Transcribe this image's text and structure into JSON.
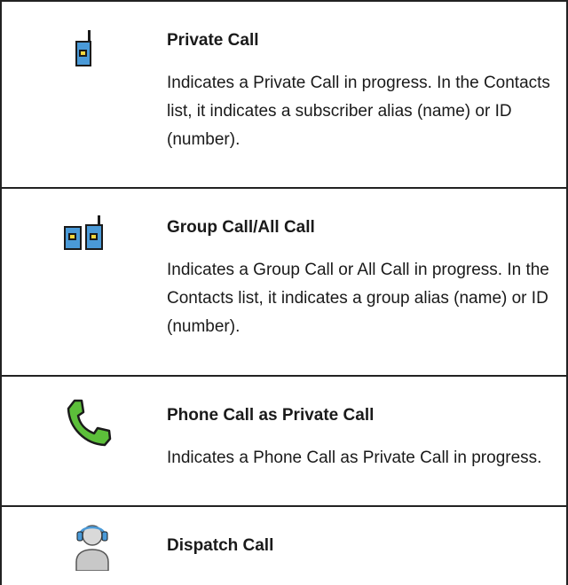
{
  "rows": [
    {
      "title": "Private Call",
      "description": "Indicates a Private Call in progress. In the Contacts list, it indicates a subscriber alias (name) or ID (number).",
      "icon": "radio-icon"
    },
    {
      "title": "Group Call/All Call",
      "description": "Indicates a Group Call or All Call in progress. In the Contacts list, it indicates a group alias (name) or ID (number).",
      "icon": "two-radios-icon"
    },
    {
      "title": "Phone Call as Private Call",
      "description": "Indicates a Phone Call as Private Call in progress.",
      "icon": "phone-handset-icon"
    },
    {
      "title": "Dispatch Call",
      "description": "",
      "icon": "dispatcher-headset-icon"
    }
  ],
  "colors": {
    "radio_blue": "#4a9ad8",
    "phone_green": "#5cbf3a",
    "border": "#222222"
  }
}
